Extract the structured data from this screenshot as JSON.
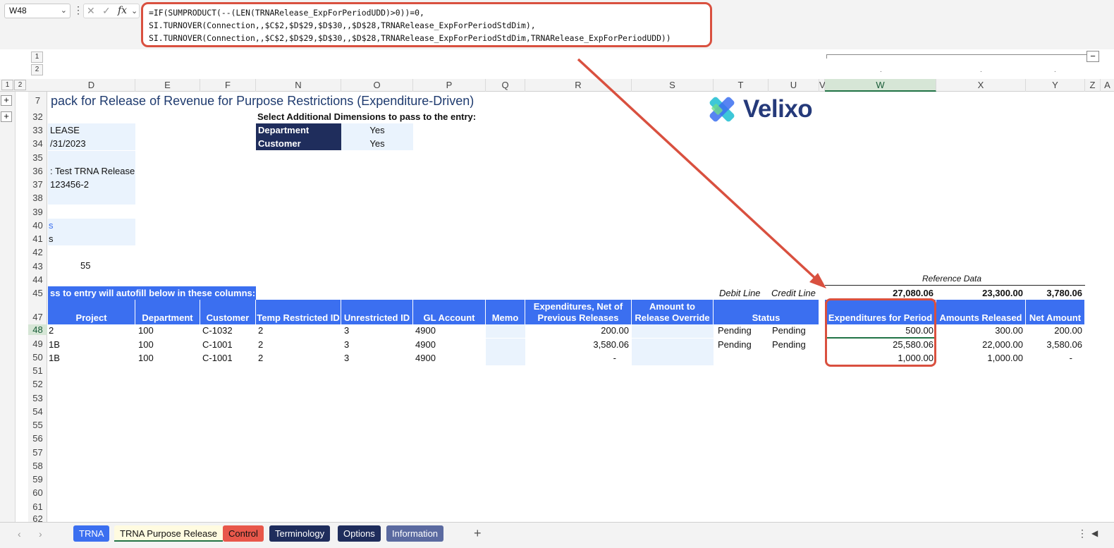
{
  "formula_bar": {
    "name_box": "W48",
    "fx": "fx",
    "formula_line1": "=IF(SUMPRODUCT(--(LEN(TRNARelease_ExpForPeriodUDD)>0))=0,",
    "formula_line2": "SI.TURNOVER(Connection,,$C$2,$D$29,$D$30,,$D$28,TRNARelease_ExpForPeriodStdDim),",
    "formula_line3": "SI.TURNOVER(Connection,,$C$2,$D$29,$D$30,,$D$28,TRNARelease_ExpForPeriodStdDim,TRNARelease_ExpForPeriodUDD))"
  },
  "outline": {
    "level1": "1",
    "level2": "1",
    "level3": "2",
    "level4": "2",
    "collapse": "−",
    "plus": "+"
  },
  "columns": [
    "D",
    "E",
    "F",
    "N",
    "O",
    "P",
    "Q",
    "R",
    "S",
    "T",
    "U",
    "V",
    "W",
    "X",
    "Y",
    "Z",
    "A"
  ],
  "rows": [
    "7",
    "32",
    "33",
    "34",
    "35",
    "36",
    "37",
    "38",
    "39",
    "40",
    "41",
    "42",
    "43",
    "44",
    "45",
    "47",
    "48",
    "49",
    "50",
    "51",
    "52",
    "53",
    "54",
    "55",
    "56",
    "57",
    "58",
    "59",
    "60",
    "61",
    "62"
  ],
  "sheet": {
    "title": "pack for Release of Revenue for Purpose Restrictions (Expenditure-Driven)",
    "brand": "Velixo",
    "select_dims_label": "Select Additional Dimensions to pass to the entry:",
    "dims": [
      {
        "name": "Department",
        "value": "Yes"
      },
      {
        "name": "Customer",
        "value": "Yes"
      }
    ],
    "left_values": {
      "r33": "LEASE",
      "r34": "/31/2023",
      "r36": ": Test TRNA Release",
      "r37": "123456-2",
      "r40": "s",
      "r41": "s",
      "r43": "55"
    },
    "autofill_label": "ss to entry will autofill below in these columns:",
    "debit_line": "Debit Line",
    "credit_line": "Credit Line",
    "reference_data": "Reference Data",
    "totals": {
      "w": "27,080.06",
      "x": "23,300.00",
      "y": "3,780.06"
    },
    "headers": {
      "project": "Project",
      "department": "Department",
      "customer": "Customer",
      "temp_restricted": "Temp Restricted ID",
      "unrestricted": "Unrestricted ID",
      "gl_account": "GL Account",
      "memo": "Memo",
      "expenditures_net": "Expenditures, Net of Previous Releases",
      "amount_override": "Amount to Release Override",
      "status": "Status",
      "exp_for_period": "Expenditures for Period",
      "amounts_released": "Amounts Released",
      "net_amount": "Net Amount"
    },
    "data_rows": [
      {
        "project": "2",
        "department": "100",
        "customer": "C-1032",
        "temp": "2",
        "unres": "3",
        "gl": "4900",
        "exp_net": "200.00",
        "status_debit": "Pending",
        "status_credit": "Pending",
        "exp_period": "500.00",
        "released": "300.00",
        "net": "200.00"
      },
      {
        "project": "1B",
        "department": "100",
        "customer": "C-1001",
        "temp": "2",
        "unres": "3",
        "gl": "4900",
        "exp_net": "3,580.06",
        "status_debit": "Pending",
        "status_credit": "Pending",
        "exp_period": "25,580.06",
        "released": "22,000.00",
        "net": "3,580.06"
      },
      {
        "project": "1B",
        "department": "100",
        "customer": "C-1001",
        "temp": "2",
        "unres": "3",
        "gl": "4900",
        "exp_net": "-",
        "status_debit": "",
        "status_credit": "",
        "exp_period": "1,000.00",
        "released": "1,000.00",
        "net": "-"
      }
    ]
  },
  "tabs": [
    {
      "label": "TRNA",
      "color": "#3b6ff0"
    },
    {
      "label": "TRNA Purpose Release",
      "color": "#fffbe0"
    },
    {
      "label": "Control",
      "color": "#e8574a"
    },
    {
      "label": "Terminology",
      "color": "#1f2d5c"
    },
    {
      "label": "Options",
      "color": "#1f2d5c"
    },
    {
      "label": "Information",
      "color": "#5b6aa0"
    }
  ],
  "tab_bar": {
    "add": "+",
    "menu": "⋮",
    "scroll": "◀",
    "prev": "‹",
    "next": "›"
  },
  "colors": {
    "accent_blue": "#3b6ff0",
    "navy": "#1f2d5c",
    "highlight_red": "#d9503f",
    "light_blue": "#eaf3fd"
  }
}
